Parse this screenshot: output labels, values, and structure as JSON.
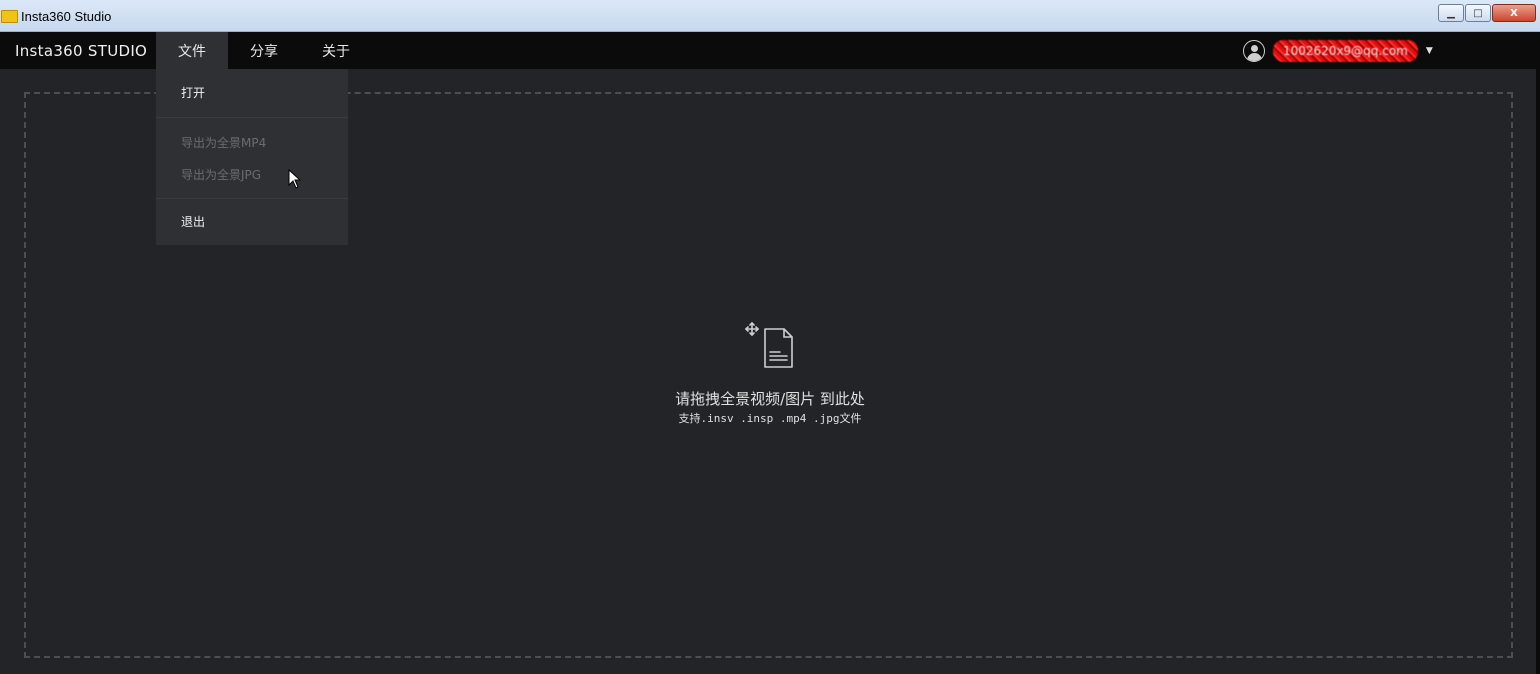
{
  "window": {
    "title": "Insta360 Studio",
    "controls": {
      "minimize": "▁",
      "maximize": "□",
      "close": "X"
    }
  },
  "menubar": {
    "logo": "Insta360 STUDIO",
    "items": [
      {
        "label": "文件",
        "active": true
      },
      {
        "label": "分享",
        "active": false
      },
      {
        "label": "关于",
        "active": false
      }
    ],
    "user": {
      "email": "1002620x9@qq.com",
      "caret": "▼"
    }
  },
  "file_menu": {
    "items": [
      {
        "label": "打开",
        "enabled": true
      },
      {
        "label": "导出为全景MP4",
        "enabled": false
      },
      {
        "label": "导出为全景JPG",
        "enabled": false
      },
      {
        "label": "退出",
        "enabled": true
      }
    ]
  },
  "drop_zone": {
    "title": "请拖拽全景视频/图片 到此处",
    "subtitle": "支持.insv .insp .mp4 .jpg文件",
    "icon": "drag-file-icon"
  },
  "colors": {
    "background": "#232427",
    "menubar": "#0b0b0b",
    "dropdown": "#2f3034",
    "disabled_text": "#6b6c70",
    "dashed_border": "#4d4e52"
  }
}
